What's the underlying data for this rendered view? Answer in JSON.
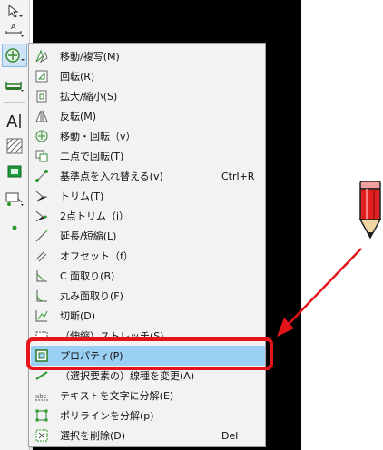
{
  "menu": {
    "items": [
      {
        "label": "移動/複写(M)",
        "shortcut": "",
        "icon": "move-copy-icon"
      },
      {
        "label": "回転(R)",
        "shortcut": "",
        "icon": "rotate-icon"
      },
      {
        "label": "拡大/縮小(S)",
        "shortcut": "",
        "icon": "scale-icon"
      },
      {
        "label": "反転(M)",
        "shortcut": "",
        "icon": "mirror-icon"
      },
      {
        "label": "移動・回転（v）",
        "shortcut": "",
        "icon": "move-rotate-icon"
      },
      {
        "label": "二点で回転(T)",
        "shortcut": "",
        "icon": "two-point-rotate-icon"
      },
      {
        "label": "基準点を入れ替える(v)",
        "shortcut": "Ctrl+R",
        "icon": "swap-base-point-icon"
      },
      {
        "label": "トリム(T)",
        "shortcut": "",
        "icon": "trim-icon"
      },
      {
        "label": "2点トリム（i）",
        "shortcut": "",
        "icon": "two-point-trim-icon"
      },
      {
        "label": "延長/短縮(L)",
        "shortcut": "",
        "icon": "extend-icon"
      },
      {
        "label": "オフセット（f）",
        "shortcut": "",
        "icon": "offset-icon"
      },
      {
        "label": "C 面取り(B)",
        "shortcut": "",
        "icon": "chamfer-icon"
      },
      {
        "label": "丸み面取り(F)",
        "shortcut": "",
        "icon": "fillet-icon"
      },
      {
        "label": "切断(D)",
        "shortcut": "",
        "icon": "cut-icon"
      },
      {
        "label": "（伸縮）ストレッチ(S)",
        "shortcut": "",
        "icon": "stretch-icon"
      },
      {
        "label": "プロパティ(P)",
        "shortcut": "",
        "icon": "properties-icon"
      },
      {
        "label": "（選択要素の）線種を変更(A)",
        "shortcut": "",
        "icon": "line-type-icon"
      },
      {
        "label": "テキストを文字に分解(E)",
        "shortcut": "",
        "icon": "explode-text-icon"
      },
      {
        "label": "ポリラインを分解(p)",
        "shortcut": "",
        "icon": "explode-polyline-icon"
      },
      {
        "label": "選択を削除(D)",
        "shortcut": "Del",
        "icon": "delete-selection-icon"
      }
    ],
    "highlighted_label": "プロパティ(P)"
  },
  "toolbar": {
    "items": [
      {
        "icon": "select-arrow-icon"
      },
      {
        "icon": "text-size-icon"
      },
      {
        "icon": "edit-tools-icon",
        "active": true
      },
      {
        "icon": "dimension-icon"
      },
      {
        "icon": "text-icon"
      },
      {
        "icon": "hatch-icon"
      },
      {
        "icon": "image-icon"
      },
      {
        "icon": "block-icon"
      },
      {
        "icon": "point-icon"
      }
    ]
  },
  "colors": {
    "highlight": "#9bd0f5",
    "callout_red": "#e3141a",
    "menu_bg": "#f2f2f2",
    "canvas": "#000000"
  }
}
